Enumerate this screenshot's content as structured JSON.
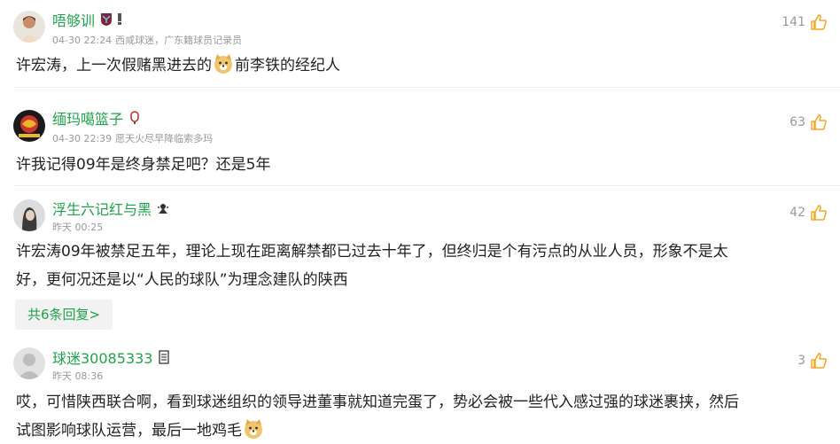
{
  "comments": [
    {
      "username": "唔够训",
      "time": "04-30 22:24",
      "tags": "西咸球迷，广东籍球员记录员",
      "likes": "141",
      "text_before": "许宏涛，上一次假赌黑进去的",
      "text_after": "前李铁的经纪人"
    },
    {
      "username": "缅玛噶篮子",
      "time": "04-30 22:39",
      "tags": "愿天火尽早降临索多玛",
      "likes": "63",
      "text": "许我记得09年是终身禁足吧？还是5年"
    },
    {
      "username": "浮生六记红与黑",
      "time": "昨天 00:25",
      "likes": "42",
      "text_line1": "许宏涛09年被禁足五年，理论上现在距离解禁都已过去十年了，但终归是个有污点的从业人员，形象不是太",
      "text_line2": "好，更何况还是以“人民的球队”为理念建队的陕西",
      "replies_label": "共6条回复>"
    },
    {
      "username": "球迷30085333",
      "time": "昨天 08:36",
      "likes": "3",
      "text_line1": "哎，可惜陕西联合啊，看到球迷组织的领导进董事就知道完蛋了，势必会被一些代入感过强的球迷裹挟，然后",
      "text_line2": "试图影响球队运营，最后一地鸡毛"
    }
  ],
  "colors": {
    "username": "#1fa34a",
    "meta": "#999999",
    "like_icon": "#f5a623",
    "body_text": "#222222"
  }
}
